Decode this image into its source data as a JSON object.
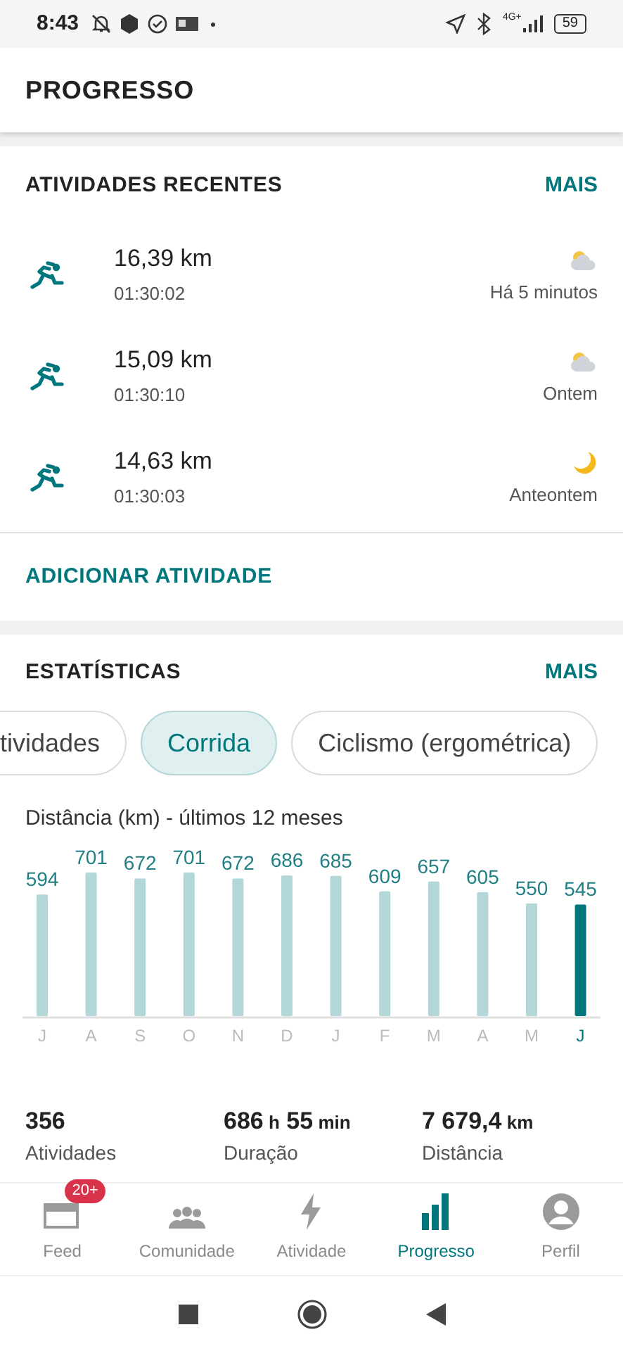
{
  "status_bar": {
    "time": "8:43",
    "network": "4G+",
    "battery": "59"
  },
  "header": {
    "title": "PROGRESSO"
  },
  "recent": {
    "title": "ATIVIDADES RECENTES",
    "more": "MAIS",
    "add_button": "ADICIONAR ATIVIDADE",
    "activities": [
      {
        "distance": "16,39 km",
        "duration": "01:30:02",
        "when": "Há 5 minutos",
        "kind": "cloudy"
      },
      {
        "distance": "15,09 km",
        "duration": "01:30:10",
        "when": "Ontem",
        "kind": "cloudy"
      },
      {
        "distance": "14,63 km",
        "duration": "01:30:03",
        "when": "Anteontem",
        "kind": "night"
      }
    ]
  },
  "stats": {
    "title": "ESTATÍSTICAS",
    "more": "MAIS",
    "filters": [
      {
        "label": "tividades",
        "selected": false
      },
      {
        "label": "Corrida",
        "selected": true
      },
      {
        "label": "Ciclismo (ergométrica)",
        "selected": false
      }
    ],
    "chart_data": {
      "type": "bar",
      "title": "Distância (km) - últimos 12 meses",
      "categories": [
        "J",
        "A",
        "S",
        "O",
        "N",
        "D",
        "J",
        "F",
        "M",
        "A",
        "M",
        "J"
      ],
      "stacked": true,
      "series": [
        {
          "color": "#b3d7d8",
          "values": [
            594,
            701,
            672,
            701,
            672,
            686,
            685,
            609,
            657,
            605,
            550,
            null
          ]
        },
        {
          "color": "#00777d",
          "values": [
            null,
            null,
            null,
            null,
            null,
            null,
            null,
            null,
            null,
            null,
            null,
            545
          ]
        }
      ],
      "data_labels": true
    },
    "summary": [
      {
        "label": "Atividades",
        "parts": [
          {
            "text": "356",
            "kind": "number"
          }
        ]
      },
      {
        "label": "Duração",
        "parts": [
          {
            "text": "686",
            "kind": "number"
          },
          {
            "text": "h",
            "kind": "unit"
          },
          {
            "text": "55",
            "kind": "number"
          },
          {
            "text": "min",
            "kind": "unit"
          }
        ]
      },
      {
        "label": "Distância",
        "parts": [
          {
            "text": "7 679,4",
            "kind": "number"
          },
          {
            "text": "km",
            "kind": "unit"
          }
        ]
      }
    ]
  },
  "bottom_nav": [
    {
      "label": "Feed",
      "selected": false,
      "badge": "20+"
    },
    {
      "label": "Comunidade",
      "selected": false
    },
    {
      "label": "Atividade",
      "selected": false
    },
    {
      "label": "Progresso",
      "selected": true
    },
    {
      "label": "Perfil",
      "selected": false
    }
  ]
}
